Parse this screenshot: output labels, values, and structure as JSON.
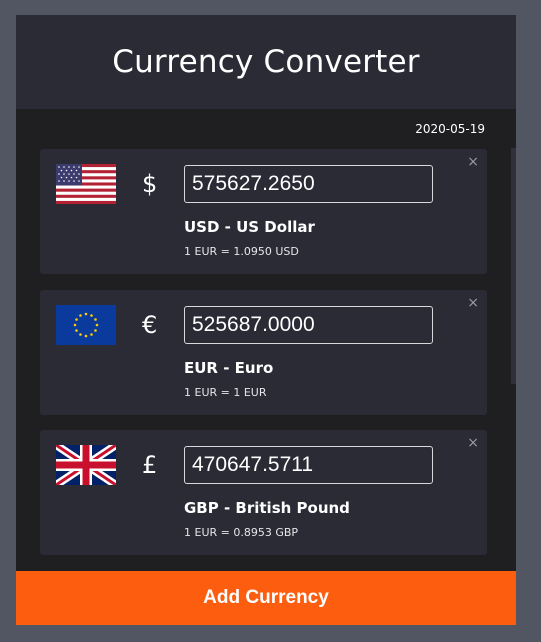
{
  "header": {
    "title": "Currency Converter"
  },
  "date": "2020-05-19",
  "currencies": [
    {
      "code_name": "USD - US Dollar",
      "symbol": "$",
      "amount": "575627.2650",
      "rate": "1 EUR = 1.0950 USD",
      "flag_icon": "us-flag-icon",
      "close": "×"
    },
    {
      "code_name": "EUR - Euro",
      "symbol": "€",
      "amount": "525687.0000",
      "rate": "1 EUR = 1 EUR",
      "flag_icon": "eu-flag-icon",
      "close": "×"
    },
    {
      "code_name": "GBP - British Pound",
      "symbol": "£",
      "amount": "470647.5711",
      "rate": "1 EUR = 0.8953 GBP",
      "flag_icon": "uk-flag-icon",
      "close": "×"
    }
  ],
  "add_button": {
    "label": "Add Currency"
  },
  "colors": {
    "background": "#525662",
    "panel": "#1f1f22",
    "card": "#2a2b35",
    "accent": "#fd5d0f"
  }
}
